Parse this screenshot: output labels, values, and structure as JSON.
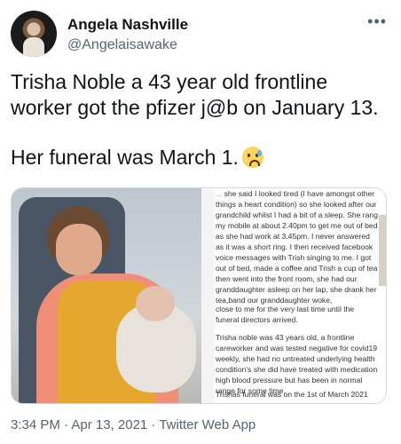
{
  "author": {
    "name": "Angela Nashville",
    "handle": "@Angelaisawake"
  },
  "menu_icon": "more-horizontal-icon",
  "tweet": {
    "line1": "Trisha Noble a 43 year old frontline worker got the pfizer j@b on January 13.",
    "line2": "Her funeral was March 1.",
    "emoji": "anxious-face-with-sweat"
  },
  "media": {
    "post_text": {
      "p1_top": "...",
      "p1": "she said I looked tired (I have amongst other things a heart condition) so she looked after our grandchild whilst I had a bit of a sleep. She rang my mobile at about 2.40pm to get me out of bed as she had work at 3.45pm. I never answered as it was a short ring. I then received facebook voice messages with Trish singing to me. I got out of bed, made a coffee and Trish a cup of tea then went into the front room, she had our granddaughter asleep on her lap, she drank her tea,band our granddaughter woke,",
      "p2": "close to me for the very last time until the funeral directors arrived.",
      "p3": "Trisha noble was 43 years old, a frontline careworker and was tested negative for covid19 weekly, she had no untreated underlying health condition's she did have treated with medication high blood pressure but has been in normal range for some time,",
      "p4": "Trishas funeral was on the 1st of March 2021"
    }
  },
  "footer": {
    "timestamp": "3:34 PM · Apr 13, 2021 · Twitter Web App"
  }
}
